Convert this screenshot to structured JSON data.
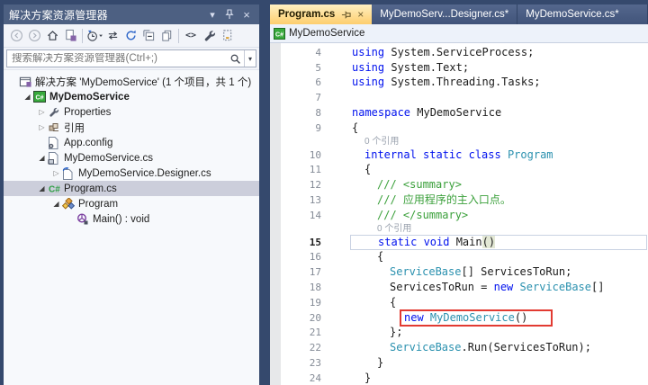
{
  "colors": {
    "title_bar": "#4D6082",
    "active_tab": "#FDCE6E",
    "keyword": "#0011EE",
    "type_name": "#2B91AF",
    "comment": "#3BA03B",
    "annotation_box": "#E23B32",
    "selection_row": "#CCCEDB"
  },
  "solution_explorer": {
    "title": "解决方案资源管理器",
    "titlebar_icons": [
      "window-position",
      "pin",
      "close"
    ],
    "toolbar_icons": [
      "back",
      "forward",
      "home",
      "switch-views",
      "sep",
      "pending-filter",
      "sync-active-document",
      "refresh",
      "collapse-all",
      "properties",
      "sep",
      "view-code",
      "wrench",
      "show-all-files"
    ],
    "search": {
      "placeholder": "搜索解决方案资源管理器(Ctrl+;)"
    },
    "tree": [
      {
        "label": "解决方案 'MyDemoService' (1 个项目，共 1 个)",
        "depth": 0,
        "icon": "solution",
        "expand": "none"
      },
      {
        "label": "MyDemoService",
        "depth": 1,
        "icon": "project-cs",
        "expand": "open",
        "bold": true
      },
      {
        "label": "Properties",
        "depth": 2,
        "icon": "wrench",
        "expand": "closed"
      },
      {
        "label": "引用",
        "depth": 2,
        "icon": "references",
        "expand": "closed"
      },
      {
        "label": "App.config",
        "depth": 2,
        "icon": "config-file",
        "expand": "none"
      },
      {
        "label": "MyDemoService.cs",
        "depth": 2,
        "icon": "component-file",
        "expand": "open"
      },
      {
        "label": "MyDemoService.Designer.cs",
        "depth": 3,
        "icon": "designer-file",
        "expand": "closed"
      },
      {
        "label": "Program.cs",
        "depth": 2,
        "icon": "cs-file",
        "expand": "open",
        "selected": true
      },
      {
        "label": "Program",
        "depth": 3,
        "icon": "class",
        "expand": "open"
      },
      {
        "label": "Main() : void",
        "depth": 4,
        "icon": "method",
        "expand": "none"
      }
    ]
  },
  "editor": {
    "tabs": [
      {
        "label": "Program.cs",
        "active": true,
        "icons": [
          "pin",
          "close"
        ]
      },
      {
        "label": "MyDemoServ...Designer.cs*",
        "active": false
      },
      {
        "label": "MyDemoService.cs*",
        "active": false
      }
    ],
    "breadcrumb": {
      "label": "MyDemoService"
    },
    "codelens_text": "0 个引用",
    "lines": [
      {
        "num": "4",
        "indent": 0,
        "tokens": [
          [
            "k",
            "using"
          ],
          [
            "p",
            " System.ServiceProcess;"
          ]
        ]
      },
      {
        "num": "5",
        "indent": 0,
        "tokens": [
          [
            "k",
            "using"
          ],
          [
            "p",
            " System.Text;"
          ]
        ]
      },
      {
        "num": "6",
        "indent": 0,
        "tokens": [
          [
            "k",
            "using"
          ],
          [
            "p",
            " System.Threading.Tasks;"
          ]
        ]
      },
      {
        "num": "7",
        "indent": 0,
        "tokens": []
      },
      {
        "num": "8",
        "indent": 0,
        "tokens": [
          [
            "k",
            "namespace"
          ],
          [
            "p",
            " MyDemoService"
          ]
        ]
      },
      {
        "num": "9",
        "indent": 0,
        "tokens": [
          [
            "p",
            "{"
          ]
        ]
      },
      {
        "lens": true,
        "indent": 1
      },
      {
        "num": "10",
        "indent": 1,
        "tokens": [
          [
            "k",
            "internal static class"
          ],
          [
            "p",
            " "
          ],
          [
            "t",
            "Program"
          ]
        ]
      },
      {
        "num": "11",
        "indent": 1,
        "tokens": [
          [
            "p",
            "{"
          ]
        ]
      },
      {
        "num": "12",
        "indent": 2,
        "tokens": [
          [
            "c",
            "/// <summary>"
          ]
        ]
      },
      {
        "num": "13",
        "indent": 2,
        "tokens": [
          [
            "c",
            "/// 应用程序的主入口点。"
          ]
        ]
      },
      {
        "num": "14",
        "indent": 2,
        "tokens": [
          [
            "c",
            "/// </summary>"
          ]
        ]
      },
      {
        "lens": true,
        "indent": 2
      },
      {
        "num": "15",
        "indent": 2,
        "current": true,
        "tokens": [
          [
            "k",
            "static void"
          ],
          [
            "p",
            " Main"
          ],
          [
            "hl",
            "()"
          ]
        ]
      },
      {
        "num": "16",
        "indent": 2,
        "tokens": [
          [
            "p",
            "{"
          ]
        ]
      },
      {
        "num": "17",
        "indent": 3,
        "tokens": [
          [
            "t",
            "ServiceBase"
          ],
          [
            "p",
            "[] ServicesToRun;"
          ]
        ]
      },
      {
        "num": "18",
        "indent": 3,
        "tokens": [
          [
            "p",
            "ServicesToRun = "
          ],
          [
            "k",
            "new"
          ],
          [
            "p",
            " "
          ],
          [
            "t",
            "ServiceBase"
          ],
          [
            "p",
            "[]"
          ]
        ]
      },
      {
        "num": "19",
        "indent": 3,
        "tokens": [
          [
            "p",
            "{"
          ]
        ]
      },
      {
        "num": "20",
        "indent": 4,
        "boxed": true,
        "tokens": [
          [
            "k",
            "new"
          ],
          [
            "p",
            " "
          ],
          [
            "t",
            "MyDemoService"
          ],
          [
            "p",
            "()"
          ]
        ]
      },
      {
        "num": "21",
        "indent": 3,
        "tokens": [
          [
            "p",
            "};"
          ]
        ]
      },
      {
        "num": "22",
        "indent": 3,
        "tokens": [
          [
            "t",
            "ServiceBase"
          ],
          [
            "p",
            ".Run(ServicesToRun);"
          ]
        ]
      },
      {
        "num": "23",
        "indent": 2,
        "tokens": [
          [
            "p",
            "}"
          ]
        ]
      },
      {
        "num": "24",
        "indent": 1,
        "tokens": [
          [
            "p",
            "}"
          ]
        ]
      }
    ]
  }
}
